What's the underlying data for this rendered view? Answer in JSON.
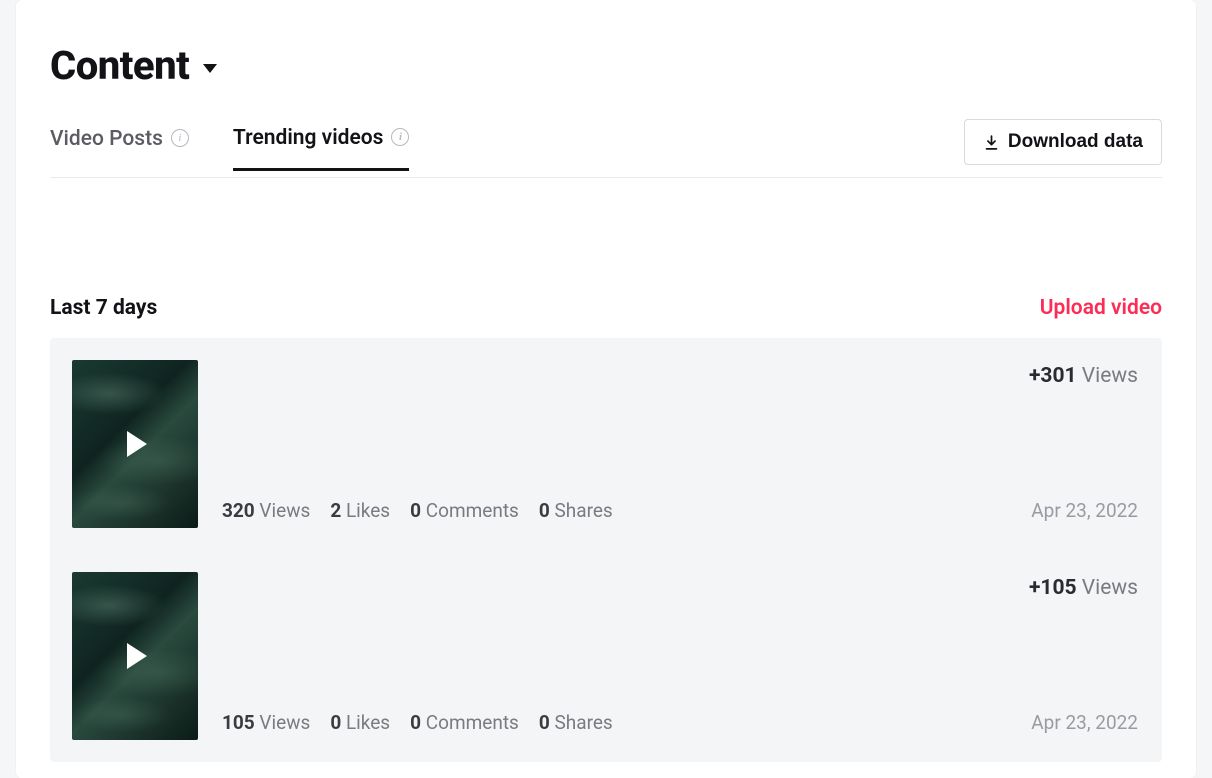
{
  "header": {
    "title": "Content"
  },
  "tabs": [
    {
      "label": "Video Posts"
    },
    {
      "label": "Trending videos"
    }
  ],
  "active_tab_index": 1,
  "download_button_label": "Download data",
  "section": {
    "title": "Last 7 days",
    "upload_label": "Upload video"
  },
  "stat_labels": {
    "views": "Views",
    "likes": "Likes",
    "comments": "Comments",
    "shares": "Shares"
  },
  "videos": [
    {
      "views": "320",
      "likes": "2",
      "comments": "0",
      "shares": "0",
      "delta_prefix": "+",
      "delta_views": "301",
      "delta_label": "Views",
      "date": "Apr 23, 2022"
    },
    {
      "views": "105",
      "likes": "0",
      "comments": "0",
      "shares": "0",
      "delta_prefix": "+",
      "delta_views": "105",
      "delta_label": "Views",
      "date": "Apr 23, 2022"
    }
  ]
}
